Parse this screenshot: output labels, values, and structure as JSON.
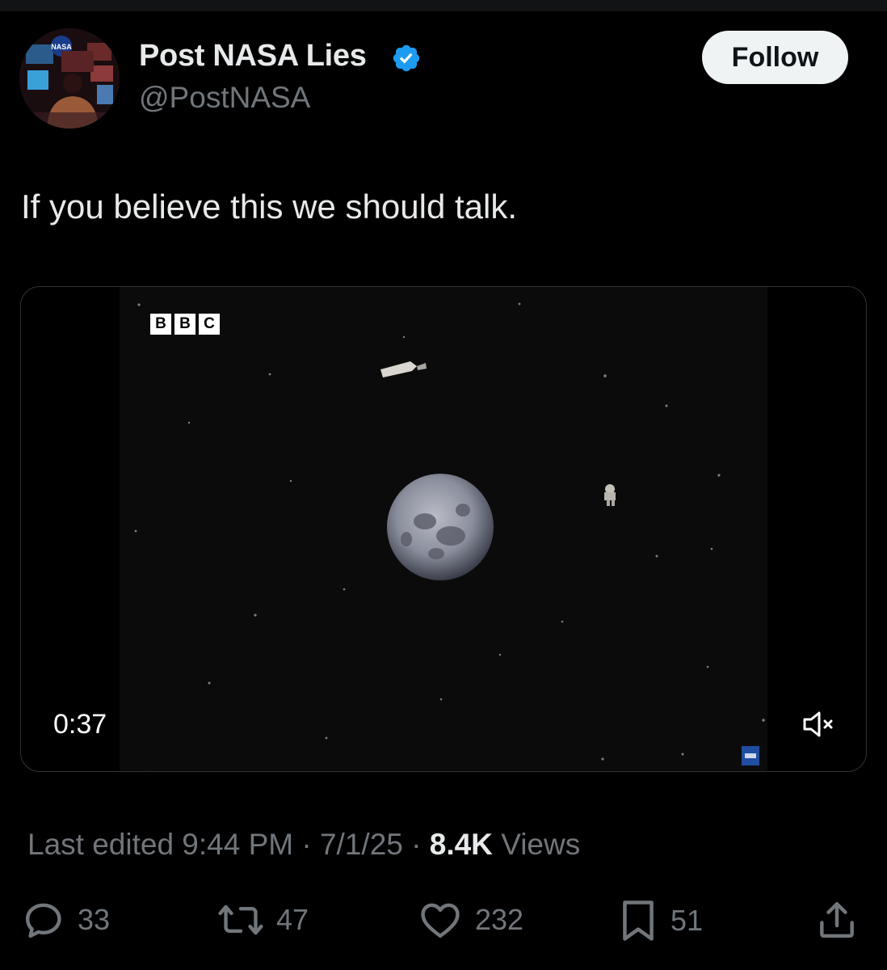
{
  "author": {
    "display_name": "Post NASA Lies",
    "handle": "@PostNASA",
    "verified_icon": "verified-badge-icon",
    "avatar_icon": "avatar-image",
    "badge_color": "#1d9bf0"
  },
  "follow_button": {
    "label": "Follow"
  },
  "post": {
    "text": "If you believe this we should talk."
  },
  "video": {
    "watermark": [
      "B",
      "B",
      "C"
    ],
    "duration": "0:37",
    "mute_icon": "volume-muted-icon"
  },
  "meta": {
    "edited": "Last edited 9:44 PM · 7/1/25",
    "separator": "·",
    "views_count": "8.4K",
    "views_label": "Views"
  },
  "actions": {
    "replies": {
      "icon": "reply-icon",
      "count": "33"
    },
    "reposts": {
      "icon": "repost-icon",
      "count": "47"
    },
    "likes": {
      "icon": "heart-icon",
      "count": "232"
    },
    "bookmarks": {
      "icon": "bookmark-icon",
      "count": "51"
    },
    "share": {
      "icon": "share-icon"
    }
  }
}
